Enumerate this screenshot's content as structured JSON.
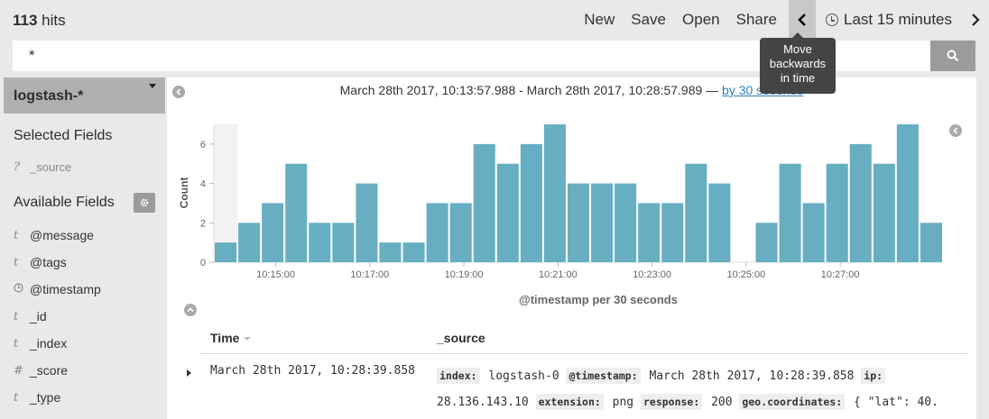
{
  "header": {
    "hits_count": "113",
    "hits_label": "hits",
    "nav": {
      "new": "New",
      "save": "Save",
      "open": "Open",
      "share": "Share"
    },
    "time_picker": "Last 15 minutes"
  },
  "tooltip": {
    "line1": "Move",
    "line2": "backwards",
    "line3": "in time"
  },
  "search": {
    "query": "*"
  },
  "sidebar": {
    "index_pattern": "logstash-*",
    "selected_title": "Selected Fields",
    "selected_fields": [
      {
        "type": "?",
        "name": "_source"
      }
    ],
    "available_title": "Available Fields",
    "available_fields": [
      {
        "type": "t",
        "name": "@message"
      },
      {
        "type": "t",
        "name": "@tags"
      },
      {
        "type": "clock",
        "name": "@timestamp"
      },
      {
        "type": "t",
        "name": "_id"
      },
      {
        "type": "t",
        "name": "_index"
      },
      {
        "type": "#",
        "name": "_score"
      },
      {
        "type": "t",
        "name": "_type"
      }
    ]
  },
  "histogram": {
    "range_text": "March 28th 2017, 10:13:57.988 - March 28th 2017, 10:28:57.989 — ",
    "interval_link": "by 30 seconds"
  },
  "chart_data": {
    "type": "bar",
    "xlabel": "@timestamp per 30 seconds",
    "ylabel": "Count",
    "ylim": [
      0,
      7
    ],
    "yticks": [
      0,
      2,
      4,
      6
    ],
    "tick_labels": [
      "10:15:00",
      "10:17:00",
      "10:19:00",
      "10:21:00",
      "10:23:00",
      "10:25:00",
      "10:27:00"
    ],
    "values": [
      1,
      2,
      3,
      5,
      2,
      2,
      4,
      1,
      1,
      3,
      3,
      6,
      5,
      6,
      7,
      4,
      4,
      4,
      3,
      3,
      5,
      4,
      0,
      2,
      5,
      3,
      5,
      6,
      5,
      7,
      2
    ],
    "bar_color": "#68aec3",
    "grid": false
  },
  "table": {
    "col_time": "Time",
    "col_source": "_source",
    "rows": [
      {
        "time": "March 28th 2017, 10:28:39.858",
        "source": [
          {
            "key": "index:",
            "value": "logstash-0"
          },
          {
            "key": "@timestamp:",
            "value": "March 28th 2017, 10:28:39.858"
          },
          {
            "key": "ip:",
            "value": "28.136.143.10"
          },
          {
            "key": "extension:",
            "value": "png"
          },
          {
            "key": "response:",
            "value": "200"
          },
          {
            "key": "geo.coordinates:",
            "value": "{ \"lat\": 40."
          }
        ]
      }
    ]
  }
}
